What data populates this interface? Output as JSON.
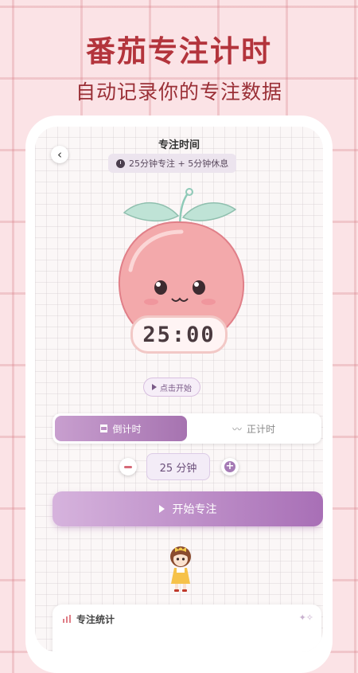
{
  "promo": {
    "headline": "番茄专注计时",
    "subline": "自动记录你的专注数据"
  },
  "screen": {
    "title": "专注时间",
    "mode_pill": "25分钟专注 + 5分钟休息",
    "timer": "25:00",
    "start_hint": "点击开始",
    "tabs": [
      {
        "label": "倒计时",
        "active": true
      },
      {
        "label": "正计时",
        "active": false
      }
    ],
    "duration": "25 分钟",
    "start_button": "开始专注",
    "stats_title": "专注统计"
  },
  "colors": {
    "accent": "#a86fb6",
    "headline": "#b3343c",
    "peach": "#f3a9ab"
  },
  "icons": [
    "back-arrow-icon",
    "clock-icon",
    "play-icon",
    "hourglass-icon",
    "wave-icon",
    "minus-icon",
    "plus-icon",
    "bar-chart-icon",
    "sparkle-icon"
  ]
}
